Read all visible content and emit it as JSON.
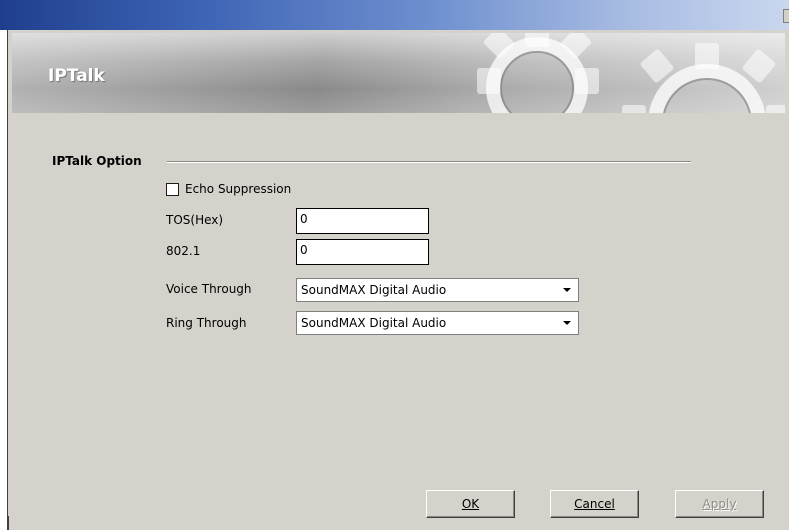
{
  "banner": {
    "title": "IPTalk"
  },
  "group": {
    "label": "IPTalk Option"
  },
  "echo_suppression": {
    "label": "Echo Suppression",
    "checked": false
  },
  "fields": {
    "tos": {
      "label": "TOS(Hex)",
      "value": "0"
    },
    "dot1": {
      "label": "802.1",
      "value": "0"
    },
    "voice_through": {
      "label": "Voice Through",
      "value": "SoundMAX Digital Audio"
    },
    "ring_through": {
      "label": "Ring Through",
      "value": "SoundMAX Digital Audio"
    }
  },
  "buttons": {
    "ok": "OK",
    "cancel": "Cancel",
    "apply": "Apply"
  },
  "icons": {
    "checkbox": "checkbox-icon",
    "dropdown": "chevron-down-icon",
    "banner_art": "gears-icon"
  },
  "colors": {
    "dialog_bg": "#d5d2cb",
    "titlebar_start": "#1f3f8e",
    "titlebar_end": "#c9d6ee"
  }
}
